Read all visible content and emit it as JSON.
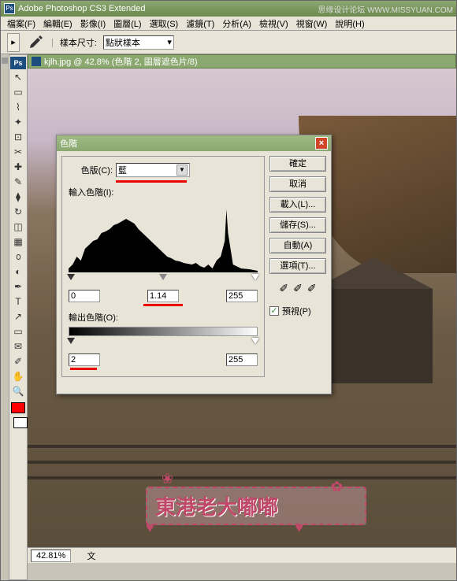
{
  "app": {
    "title": "Adobe Photoshop CS3 Extended",
    "watermark": "思缘设计论坛 WWW.MISSYUAN.COM"
  },
  "menu": {
    "file": "檔案(F)",
    "edit": "編輯(E)",
    "image": "影像(I)",
    "layer": "圖層(L)",
    "select": "選取(S)",
    "filter": "濾鏡(T)",
    "analysis": "分析(A)",
    "view": "檢視(V)",
    "window": "視窗(W)",
    "help": "說明(H)"
  },
  "optbar": {
    "sample_label": "樣本尺寸:",
    "sample_value": "點狀樣本"
  },
  "doc": {
    "title": "kjlh.jpg @ 42.8% (色階 2, 圖層遮色片/8)"
  },
  "status": {
    "zoom": "42.81%",
    "info": "文"
  },
  "dialog": {
    "title": "色階",
    "channel_label": "色版(C):",
    "channel_value": "藍",
    "input_label": "輸入色階(I):",
    "output_label": "輸出色階(O):",
    "in_black": "0",
    "in_gamma": "1.14",
    "in_white": "255",
    "out_black": "2",
    "out_white": "255",
    "ok": "確定",
    "cancel": "取消",
    "load": "載入(L)...",
    "save": "儲存(S)...",
    "auto": "自動(A)",
    "options": "選項(T)...",
    "preview": "預視(P)"
  },
  "overlay": {
    "text": "東港老大嘟嘟"
  }
}
